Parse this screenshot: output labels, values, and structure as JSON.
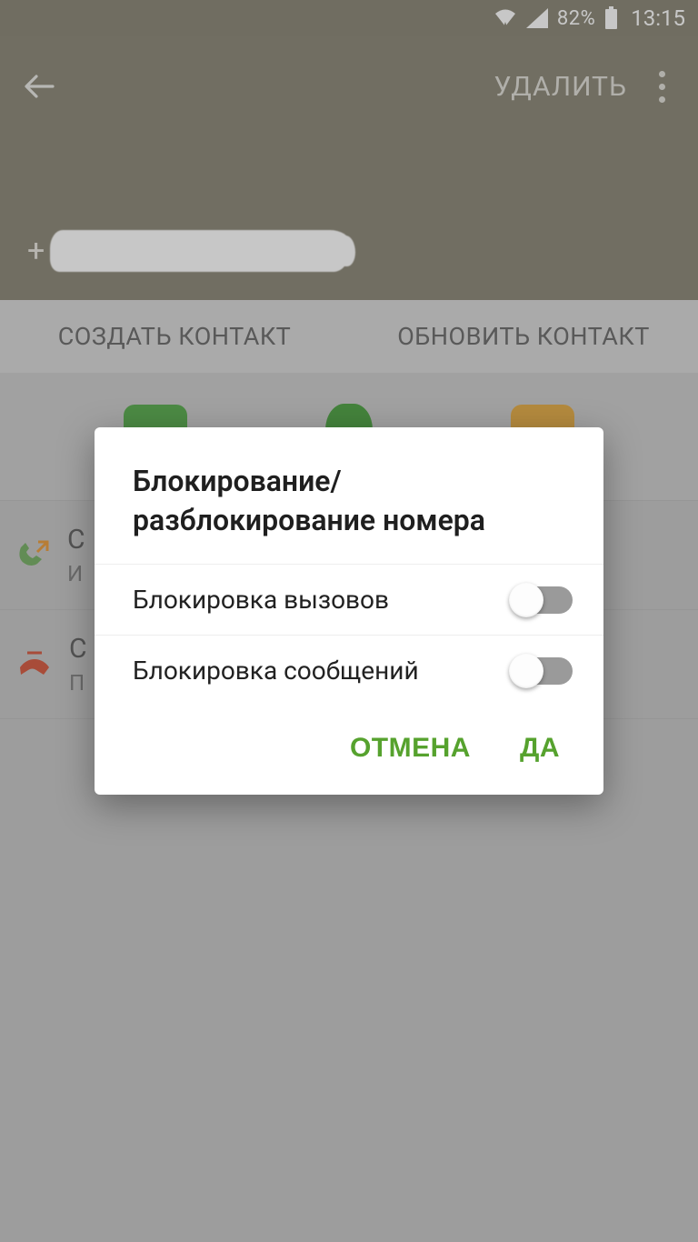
{
  "status": {
    "battery_pct": "82%",
    "time": "13:15"
  },
  "header": {
    "delete_label": "УДАЛИТЬ",
    "phone_prefix": "+"
  },
  "tabs": {
    "create": "СОЗДАТЬ КОНТАКТ",
    "update": "ОБНОВИТЬ КОНТАКТ"
  },
  "bg_list": {
    "row1_a": "С",
    "row1_b": "И",
    "row2_a": "С",
    "row2_b": "П"
  },
  "dialog": {
    "title": "Блокирование/ разблокирование номера",
    "block_calls": "Блокировка вызовов",
    "block_messages": "Блокировка сообщений",
    "cancel": "ОТМЕНА",
    "ok": "ДА"
  }
}
